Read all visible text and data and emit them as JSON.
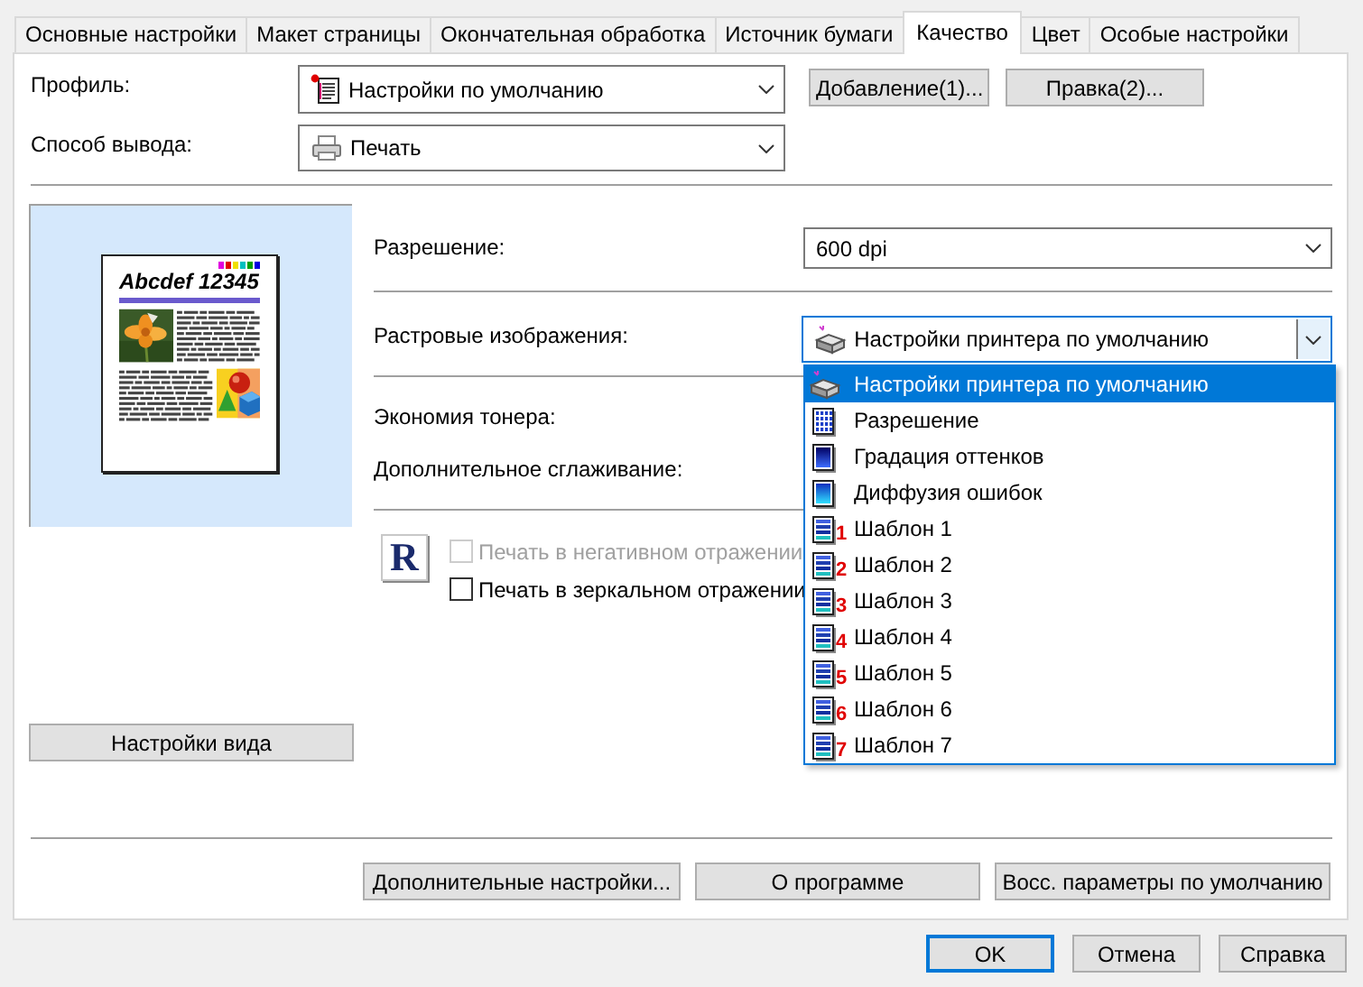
{
  "tabs": [
    {
      "label": "Основные настройки",
      "selected": false
    },
    {
      "label": "Макет страницы",
      "selected": false
    },
    {
      "label": "Окончательная обработка",
      "selected": false
    },
    {
      "label": "Источник бумаги",
      "selected": false
    },
    {
      "label": "Качество",
      "selected": true
    },
    {
      "label": "Цвет",
      "selected": false
    },
    {
      "label": "Особые настройки",
      "selected": false
    }
  ],
  "profile": {
    "label": "Профиль:",
    "value": "Настройки по умолчанию"
  },
  "profile_buttons": [
    "Добавление(1)...",
    "Правка(2)..."
  ],
  "output": {
    "label": "Способ вывода:",
    "value": "Печать"
  },
  "preview": {
    "title": "Abcdef 12345"
  },
  "view_settings_button": "Настройки вида",
  "resolution": {
    "label": "Разрешение:",
    "value": "600 dpi"
  },
  "raster": {
    "label": "Растровые изображения:",
    "value": "Настройки принтера по умолчанию",
    "expanded": true,
    "options": [
      {
        "label": "Настройки принтера по умолчанию",
        "kind": "printer",
        "selected": true
      },
      {
        "label": "Разрешение",
        "kind": "grid",
        "selected": false
      },
      {
        "label": "Градация оттенков",
        "kind": "gradation",
        "selected": false
      },
      {
        "label": "Диффузия ошибок",
        "kind": "diffusion",
        "selected": false
      },
      {
        "label": "Шаблон 1",
        "kind": "template",
        "badge": "1",
        "selected": false
      },
      {
        "label": "Шаблон 2",
        "kind": "template",
        "badge": "2",
        "selected": false
      },
      {
        "label": "Шаблон 3",
        "kind": "template",
        "badge": "3",
        "selected": false
      },
      {
        "label": "Шаблон 4",
        "kind": "template",
        "badge": "4",
        "selected": false
      },
      {
        "label": "Шаблон 5",
        "kind": "template",
        "badge": "5",
        "selected": false
      },
      {
        "label": "Шаблон 6",
        "kind": "template",
        "badge": "6",
        "selected": false
      },
      {
        "label": "Шаблон 7",
        "kind": "template",
        "badge": "7",
        "selected": false
      }
    ]
  },
  "toner_saving": {
    "label": "Экономия тонера:"
  },
  "smoothing": {
    "label": "Дополнительное сглаживание:"
  },
  "orientation_sample": "R",
  "checkboxes": [
    {
      "label": "Печать в негативном отражении",
      "checked": false,
      "disabled": true
    },
    {
      "label": "Печать в зеркальном отражении",
      "checked": false,
      "disabled": false
    }
  ],
  "footer_buttons": [
    "Дополнительные настройки...",
    "О программе",
    "Восс. параметры по умолчанию"
  ],
  "dialog_buttons": [
    {
      "label": "OK",
      "default": true
    },
    {
      "label": "Отмена",
      "default": false
    },
    {
      "label": "Справка",
      "default": false
    }
  ]
}
